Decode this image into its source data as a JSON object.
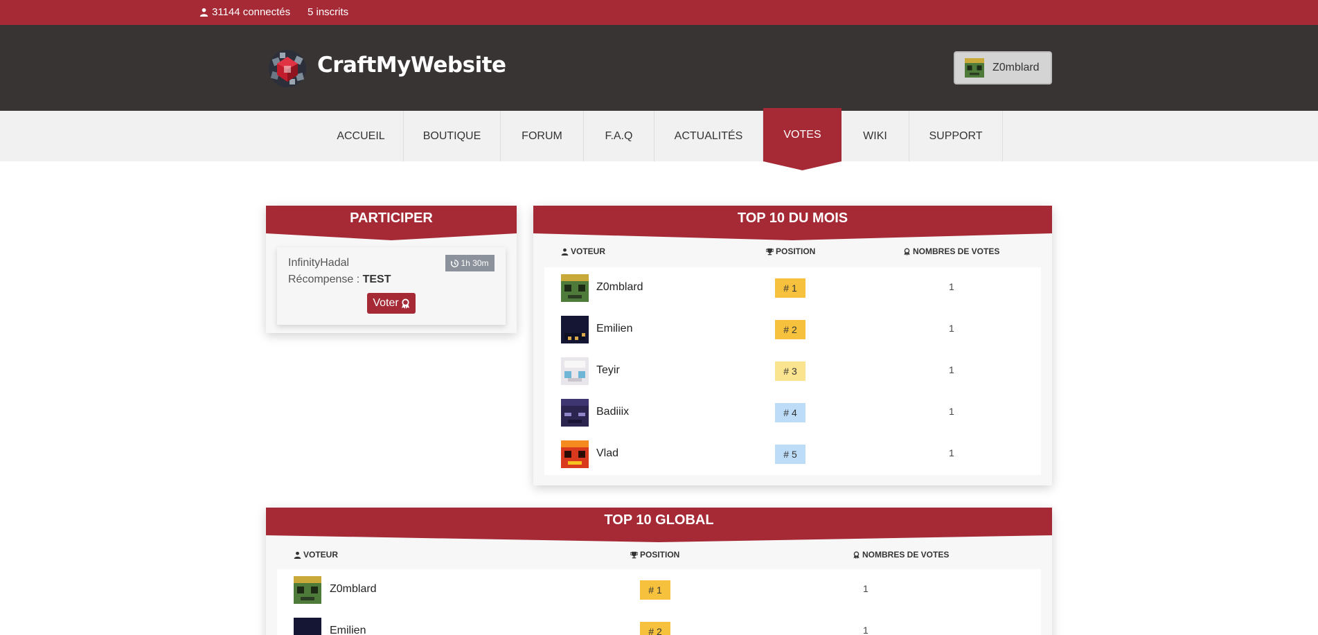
{
  "topbar": {
    "connected": "31144 connectés",
    "registered": "5 inscrits"
  },
  "header": {
    "brand": "CraftMyWebsite",
    "user": "Z0mblard"
  },
  "nav": {
    "items": [
      {
        "label": "ACCUEIL",
        "active": false
      },
      {
        "label": "BOUTIQUE",
        "active": false
      },
      {
        "label": "FORUM",
        "active": false
      },
      {
        "label": "F.A.Q",
        "active": false
      },
      {
        "label": "ACTUALITÉS",
        "active": false
      },
      {
        "label": "VOTES",
        "active": true
      },
      {
        "label": "WIKI",
        "active": false
      },
      {
        "label": "SUPPORT",
        "active": false
      }
    ]
  },
  "participate": {
    "title": "PARTICIPER",
    "site": "InfinityHadal",
    "reward_label": "Récompense : ",
    "reward_value": "TEST",
    "timer": "1h 30m",
    "vote_button": "Voter"
  },
  "headers": {
    "voter": "VOTEUR",
    "position": "POSITION",
    "votes": "NOMBRES DE VOTES"
  },
  "top_month": {
    "title": "TOP 10 DU MOIS",
    "rows": [
      {
        "name": "Z0mblard",
        "position": "# 1",
        "votes": "1",
        "avatar": "zombie-head",
        "badge_color": "#f6c23e"
      },
      {
        "name": "Emilien",
        "position": "# 2",
        "votes": "1",
        "avatar": "dark-head",
        "badge_color": "#f6c23e"
      },
      {
        "name": "Teyir",
        "position": "# 3",
        "votes": "1",
        "avatar": "white-head",
        "badge_color": "#fbe48f"
      },
      {
        "name": "Badiiix",
        "position": "# 4",
        "votes": "1",
        "avatar": "purple-head",
        "badge_color": "#bcdcf7"
      },
      {
        "name": "Vlad",
        "position": "# 5",
        "votes": "1",
        "avatar": "red-head",
        "badge_color": "#bcdcf7"
      }
    ]
  },
  "top_global": {
    "title": "TOP 10 GLOBAL",
    "rows": [
      {
        "name": "Z0mblard",
        "position": "# 1",
        "votes": "1",
        "avatar": "zombie-head",
        "badge_color": "#f6c23e"
      },
      {
        "name": "Emilien",
        "position": "# 2",
        "votes": "1",
        "avatar": "dark-head",
        "badge_color": "#f6c23e"
      }
    ]
  },
  "colors": {
    "primary": "#a52a36",
    "header_bg": "#383434",
    "nav_bg": "#f1f1f1"
  }
}
